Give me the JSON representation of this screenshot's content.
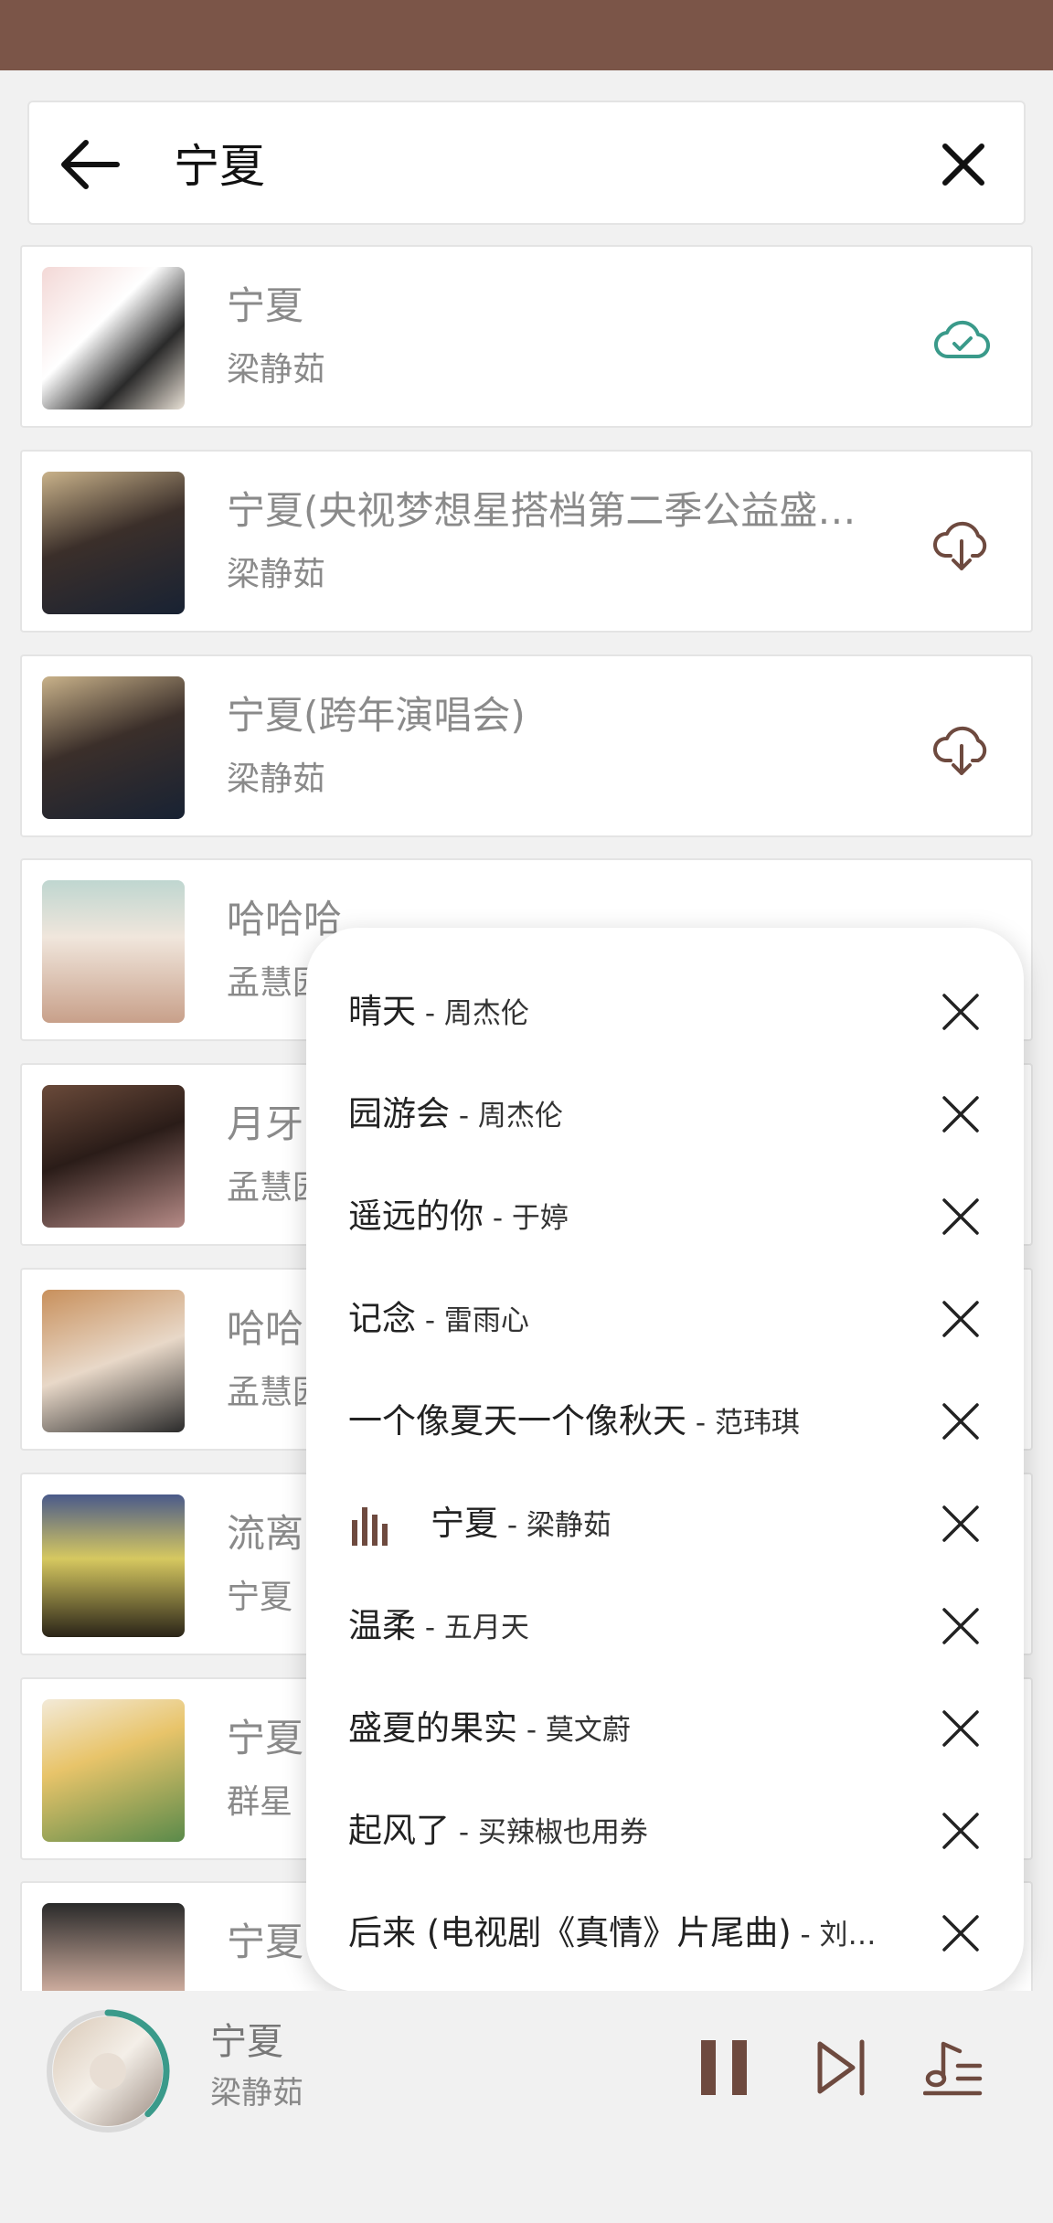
{
  "search": {
    "query": "宁夏"
  },
  "results": [
    {
      "title": "宁夏",
      "artist": "梁静茹",
      "status": "downloaded"
    },
    {
      "title": "宁夏(央视梦想星搭档第二季公益盛…",
      "artist": "梁静茹",
      "status": "download"
    },
    {
      "title": "宁夏(跨年演唱会)",
      "artist": "梁静茹",
      "status": "download"
    },
    {
      "title": "哈哈哈",
      "artist": "孟慧园",
      "status": "download"
    },
    {
      "title": "月牙",
      "artist": "孟慧园",
      "status": "download"
    },
    {
      "title": "哈哈",
      "artist": "孟慧园",
      "status": "download"
    },
    {
      "title": "流离",
      "artist": "宁夏",
      "status": "download"
    },
    {
      "title": "宁夏",
      "artist": "群星",
      "status": "download"
    },
    {
      "title": "宁夏",
      "artist": "",
      "status": "download"
    }
  ],
  "queue": [
    {
      "title": "晴天",
      "artist": " - 周杰伦"
    },
    {
      "title": "园游会",
      "artist": " - 周杰伦"
    },
    {
      "title": "遥远的你",
      "artist": " - 于婷"
    },
    {
      "title": "记念",
      "artist": " - 雷雨心"
    },
    {
      "title": "一个像夏天一个像秋天",
      "artist": " - 范玮琪"
    },
    {
      "title": "宁夏",
      "artist": " - 梁静茹",
      "playing": true
    },
    {
      "title": "温柔",
      "artist": " - 五月天"
    },
    {
      "title": "盛夏的果实",
      "artist": " - 莫文蔚"
    },
    {
      "title": "起风了",
      "artist": " - 买辣椒也用券"
    },
    {
      "title": "后来 (电视剧《真情》片尾曲)",
      "artist": " - 刘…"
    }
  ],
  "player": {
    "title": "宁夏",
    "artist": "梁静茹",
    "progress": 0.38
  },
  "colors": {
    "status_bar": "#7b5548",
    "accent_teal": "#3a9a8a",
    "accent_brown": "#6e4a3f"
  }
}
